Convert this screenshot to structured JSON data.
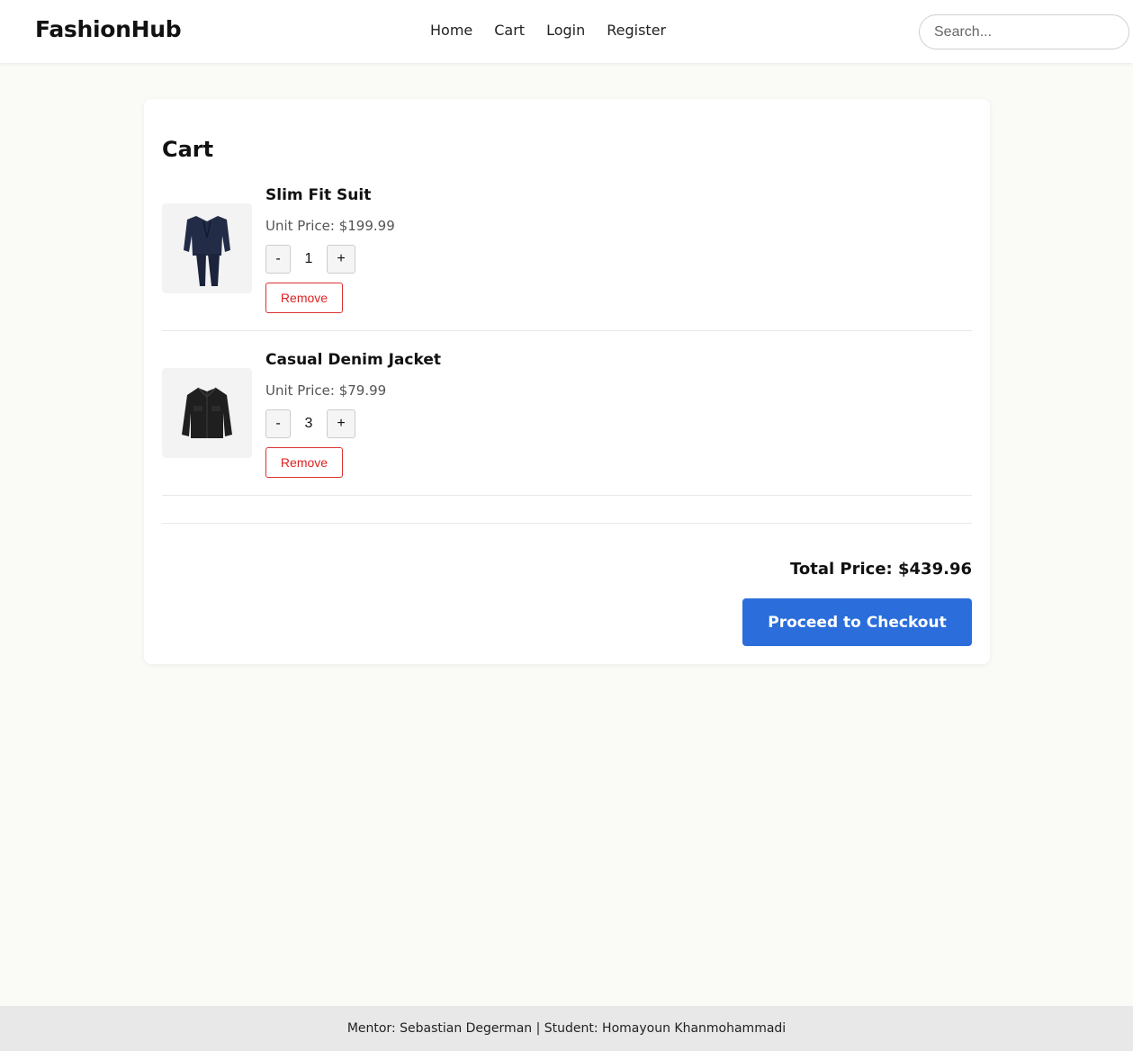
{
  "header": {
    "logo": "FashionHub",
    "nav": [
      "Home",
      "Cart",
      "Login",
      "Register"
    ],
    "search_placeholder": "Search..."
  },
  "cart": {
    "title": "Cart",
    "items": [
      {
        "name": "Slim Fit Suit",
        "unit_price": "Unit Price: $199.99",
        "quantity": "1",
        "minus": "-",
        "plus": "+",
        "remove": "Remove",
        "icon": "suit-image"
      },
      {
        "name": "Casual Denim Jacket",
        "unit_price": "Unit Price: $79.99",
        "quantity": "3",
        "minus": "-",
        "plus": "+",
        "remove": "Remove",
        "icon": "jacket-image"
      }
    ],
    "total": "Total Price: $439.96",
    "checkout": "Proceed to Checkout"
  },
  "footer": {
    "text": "Mentor: Sebastian Degerman | Student: Homayoun Khanmohammadi"
  },
  "colors": {
    "accent": "#2a6ddb",
    "remove": "#dd2222",
    "background": "#fafaf6"
  }
}
